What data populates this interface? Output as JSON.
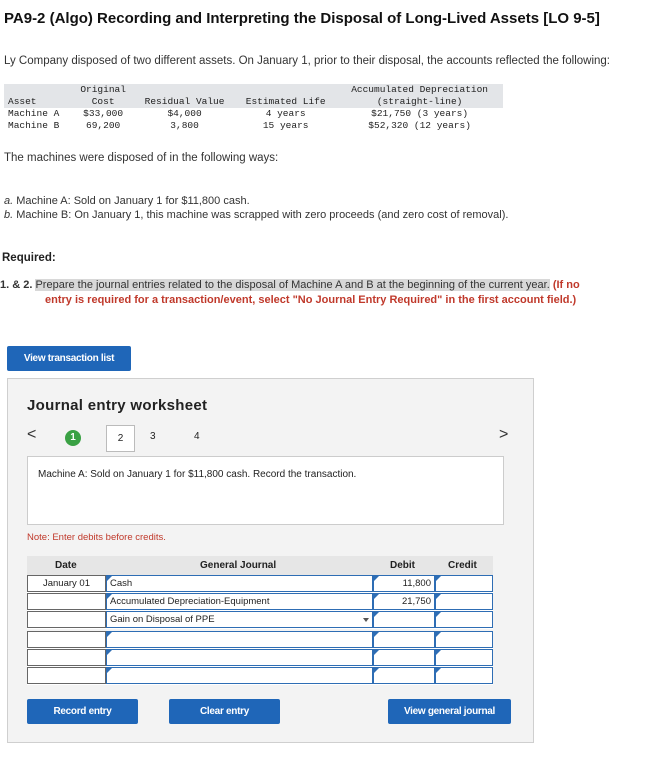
{
  "page": {
    "title": "PA9-2 (Algo) Recording and Interpreting the Disposal of Long-Lived Assets [LO 9-5]",
    "intro": "Ly Company disposed of two different assets. On January 1, prior to their disposal, the accounts reflected the following:",
    "disposed_text": "The machines were disposed of in the following ways:",
    "item_a_letter": "a.",
    "item_a": " Machine A: Sold on January 1 for $11,800 cash.",
    "item_b_letter": "b.",
    "item_b": " Machine B: On January 1, this machine was scrapped with zero proceeds (and zero cost of removal).",
    "required_label": "Required:",
    "instr_number": "1. & 2.",
    "instr_highlight": "Prepare the journal entries related to the disposal of Machine A and B at the beginning of the current year.",
    "instr_red_1": "(If no",
    "instr_red_2": "entry is required for a transaction/event, select \"No Journal Entry Required\" in the first account field.)"
  },
  "asset_table": {
    "headers": {
      "asset": "Asset",
      "cost_1": "Original",
      "cost_2": "Cost",
      "residual": "Residual Value",
      "life": "Estimated Life",
      "accum_1": "Accumulated Depreciation",
      "accum_2": "(straight-line)"
    },
    "rows": [
      {
        "asset": "Machine A",
        "cost": "$33,000",
        "residual": "$4,000",
        "life": "4 years",
        "accum": "$21,750 (3 years)"
      },
      {
        "asset": "Machine B",
        "cost": "69,200",
        "residual": "3,800",
        "life": "15 years",
        "accum": "$52,320 (12 years)"
      }
    ]
  },
  "buttons": {
    "view_transaction_list": "View transaction list",
    "record_entry": "Record entry",
    "clear_entry": "Clear entry",
    "view_general_journal": "View general journal"
  },
  "worksheet": {
    "title": "Journal entry worksheet",
    "nav_prev": "<",
    "nav_next": ">",
    "steps": [
      "1",
      "2",
      "3",
      "4"
    ],
    "transaction_desc": "Machine A: Sold on January 1 for $11,800 cash. Record the transaction.",
    "note": "Note: Enter debits before credits.",
    "headers": {
      "date": "Date",
      "journal": "General Journal",
      "debit": "Debit",
      "credit": "Credit"
    },
    "rows": [
      {
        "date": "January 01",
        "account": "Cash",
        "debit": "11,800",
        "credit": ""
      },
      {
        "date": "",
        "account": "Accumulated Depreciation-Equipment",
        "debit": "21,750",
        "credit": ""
      },
      {
        "date": "",
        "account": "Gain on Disposal of PPE",
        "debit": "",
        "credit": ""
      },
      {
        "date": "",
        "account": "",
        "debit": "",
        "credit": ""
      },
      {
        "date": "",
        "account": "",
        "debit": "",
        "credit": ""
      },
      {
        "date": "",
        "account": "",
        "debit": "",
        "credit": ""
      }
    ]
  },
  "colors": {
    "button_blue": "#1f66b8",
    "step_green": "#3aa144",
    "input_border": "#2e6db4",
    "note_red": "#c0392b"
  }
}
